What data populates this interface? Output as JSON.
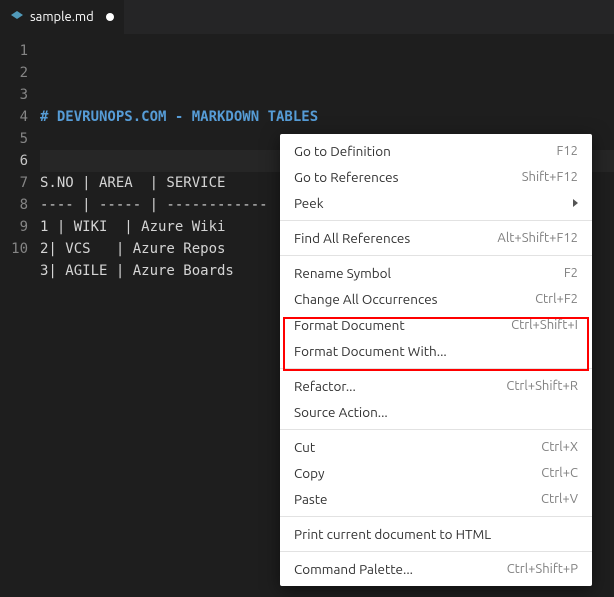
{
  "tab": {
    "filename": "sample.md"
  },
  "gutter": [
    "1",
    "2",
    "3",
    "4",
    "5",
    "6",
    "7",
    "8",
    "9",
    "10"
  ],
  "gutter_current_index": 5,
  "code": {
    "heading": "# DEVRUNOPS.COM - MARKDOWN TABLES",
    "lines": [
      "",
      "",
      "S.NO | AREA  | SERVICE",
      "---- | ----- | ------------",
      "1 | WIKI  | Azure Wiki",
      "2| VCS   | Azure Repos",
      "3| AGILE | Azure Boards",
      ""
    ]
  },
  "menu": {
    "groups": [
      [
        {
          "label": "Go to Definition",
          "shortcut": "F12",
          "submenu": false
        },
        {
          "label": "Go to References",
          "shortcut": "Shift+F12",
          "submenu": false
        },
        {
          "label": "Peek",
          "shortcut": "",
          "submenu": true
        }
      ],
      [
        {
          "label": "Find All References",
          "shortcut": "Alt+Shift+F12",
          "submenu": false
        }
      ],
      [
        {
          "label": "Rename Symbol",
          "shortcut": "F2",
          "submenu": false
        },
        {
          "label": "Change All Occurrences",
          "shortcut": "Ctrl+F2",
          "submenu": false
        },
        {
          "label": "Format Document",
          "shortcut": "Ctrl+Shift+I",
          "submenu": false
        },
        {
          "label": "Format Document With...",
          "shortcut": "",
          "submenu": false
        }
      ],
      [
        {
          "label": "Refactor...",
          "shortcut": "Ctrl+Shift+R",
          "submenu": false
        },
        {
          "label": "Source Action...",
          "shortcut": "",
          "submenu": false
        }
      ],
      [
        {
          "label": "Cut",
          "shortcut": "Ctrl+X",
          "submenu": false
        },
        {
          "label": "Copy",
          "shortcut": "Ctrl+C",
          "submenu": false
        },
        {
          "label": "Paste",
          "shortcut": "Ctrl+V",
          "submenu": false
        }
      ],
      [
        {
          "label": "Print current document to HTML",
          "shortcut": "",
          "submenu": false
        }
      ],
      [
        {
          "label": "Command Palette...",
          "shortcut": "Ctrl+Shift+P",
          "submenu": false
        }
      ]
    ]
  }
}
